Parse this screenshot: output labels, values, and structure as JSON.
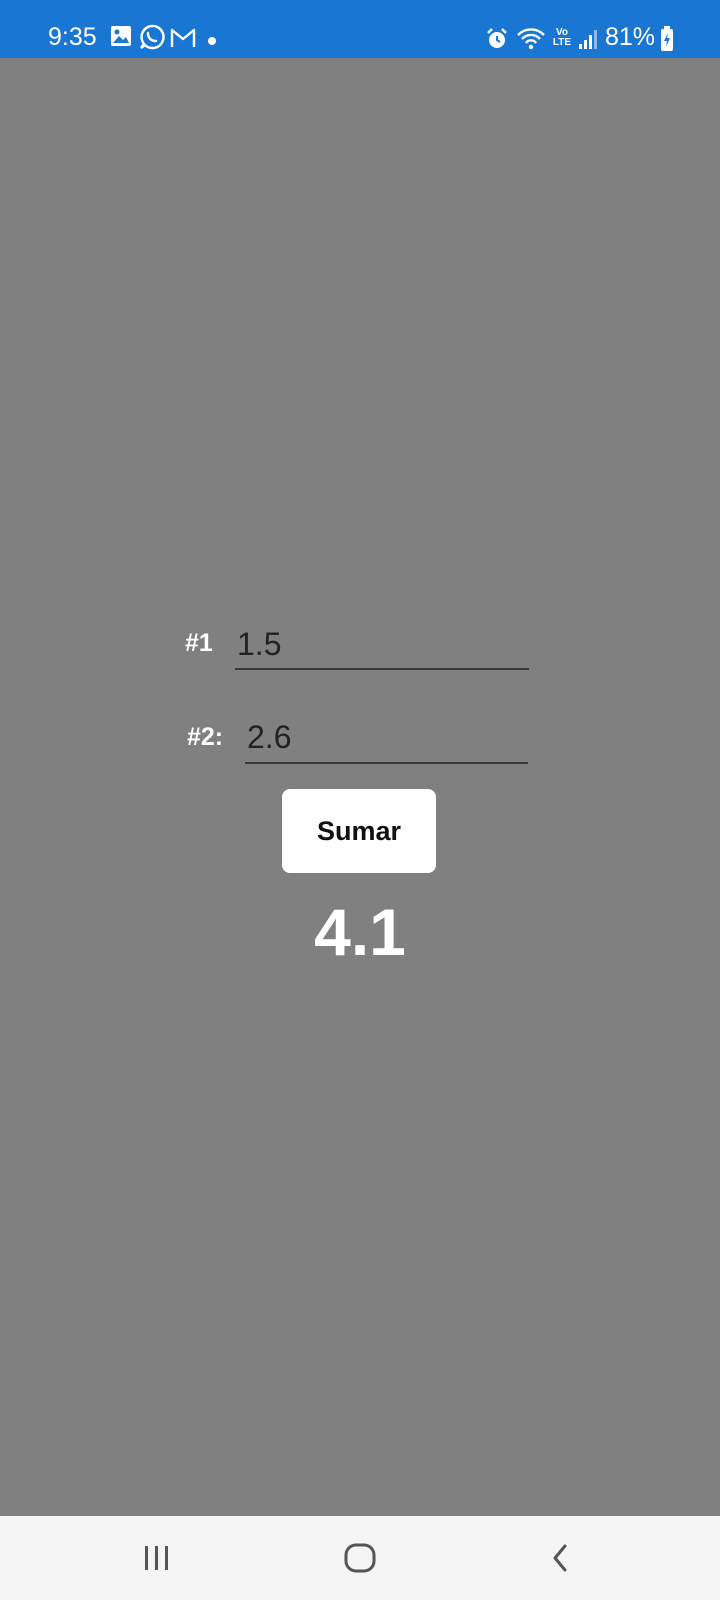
{
  "status_bar": {
    "time": "9:35",
    "notification_icons": [
      "gallery-icon",
      "whatsapp-icon",
      "gmail-icon"
    ],
    "system_icons": [
      "alarm-icon",
      "wifi-icon",
      "volte-icon",
      "signal-icon",
      "battery-charging-icon"
    ],
    "volte_label_top": "Vo",
    "volte_label_bottom": "LTE",
    "battery": "81%",
    "background_color": "#1976D2"
  },
  "form": {
    "field1": {
      "label": "#1",
      "value": "1.5"
    },
    "field2": {
      "label": "#2:",
      "value": "2.6"
    },
    "sum_button_label": "Sumar",
    "result": "4.1",
    "background_color": "#808080"
  },
  "nav_bar": {
    "items": [
      "recent-apps-icon",
      "home-icon",
      "back-icon"
    ]
  }
}
